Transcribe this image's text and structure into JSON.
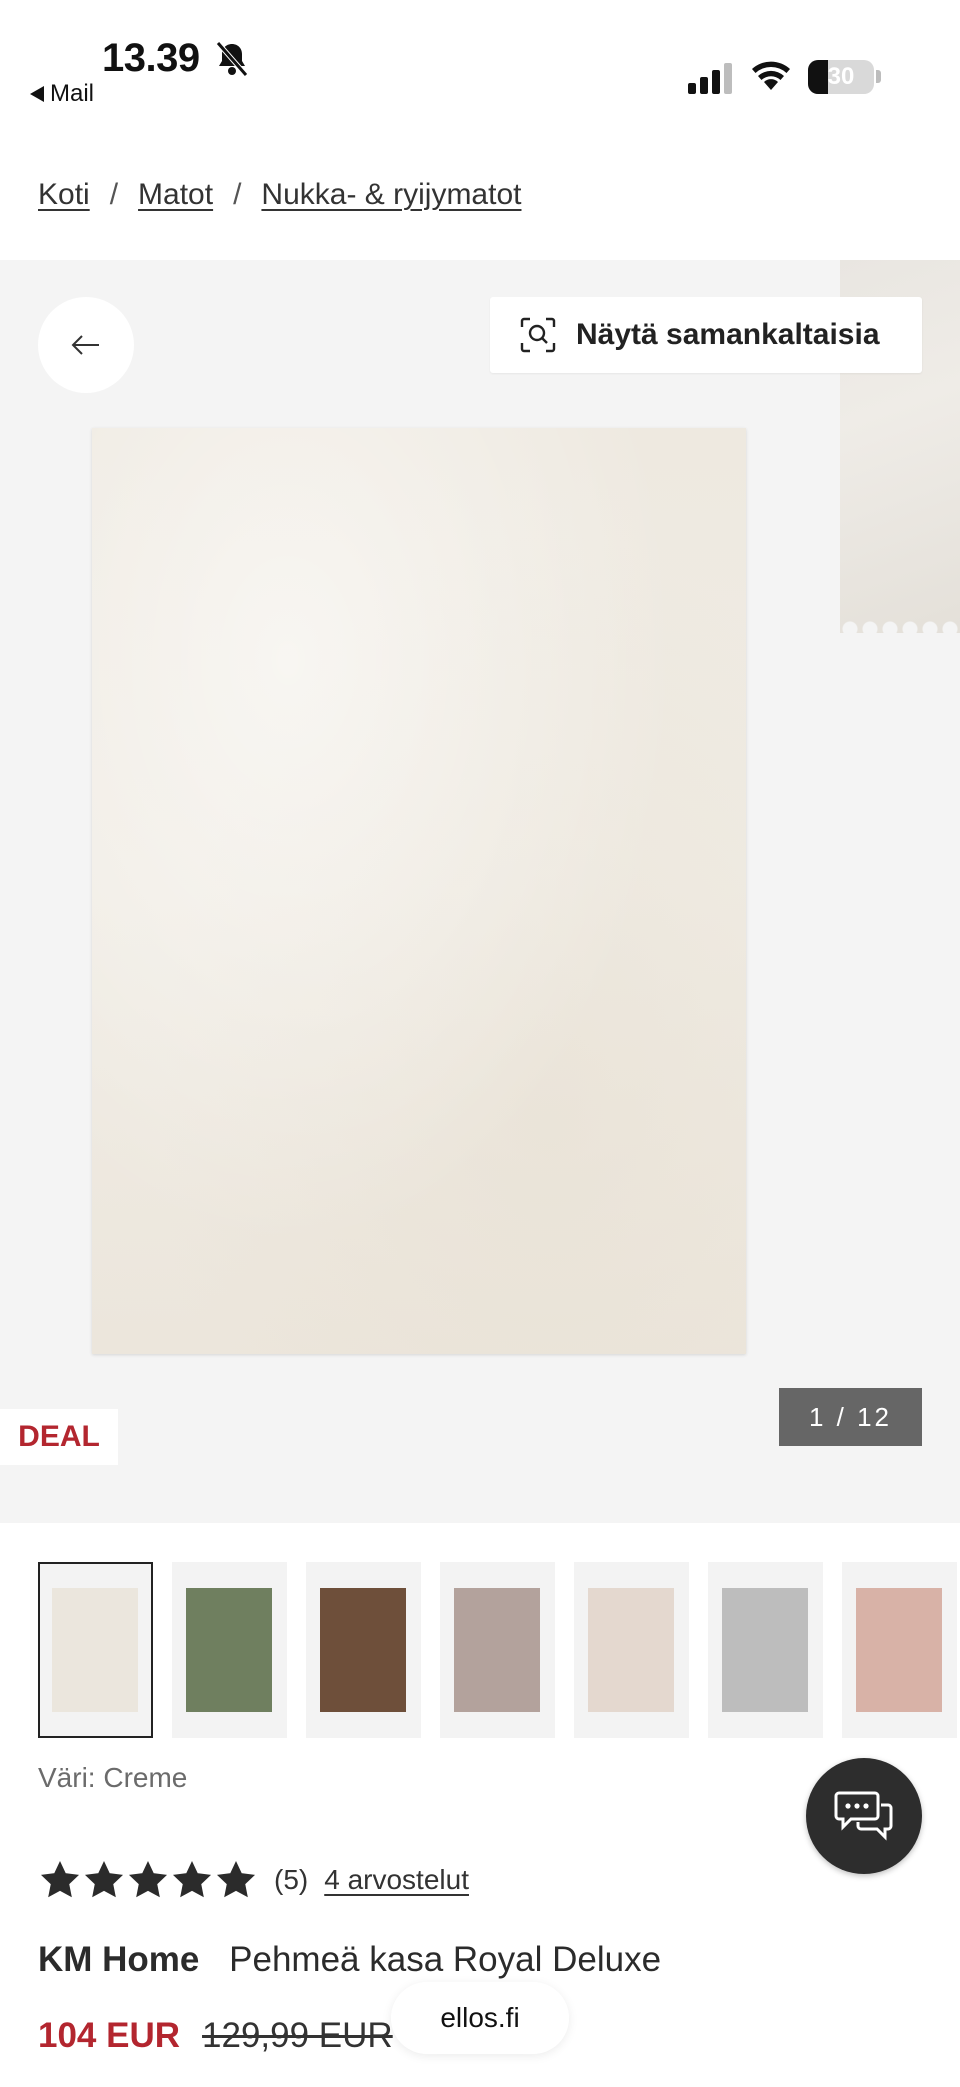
{
  "status_bar": {
    "time": "13.39",
    "back_app": "Mail",
    "battery": "30",
    "battery_level": 0.3
  },
  "breadcrumb": {
    "items": [
      "Koti",
      "Matot",
      "Nukka- & ryijymatot"
    ],
    "separator": "/"
  },
  "gallery": {
    "similar_label": "Näytä samankaltaisia",
    "deal_label": "DEAL",
    "counter": "1 / 12"
  },
  "thumbnails": [
    {
      "color": "#ebe6dd",
      "selected": true
    },
    {
      "color": "#6f7f5f",
      "selected": false
    },
    {
      "color": "#6e4f3a",
      "selected": false
    },
    {
      "color": "#b3a29c",
      "selected": false
    },
    {
      "color": "#e4d8cf",
      "selected": false
    },
    {
      "color": "#bdbdbd",
      "selected": false
    },
    {
      "color": "#d8b2a7",
      "selected": false
    }
  ],
  "product": {
    "color_label": "Väri: Creme",
    "rating_value": 5,
    "rating_count": "(5)",
    "reviews_link": "4 arvostelut",
    "brand": "KM Home",
    "name": "Pehmeä kasa Royal Deluxe",
    "price": "104 EUR",
    "old_price": "129,99 EUR"
  },
  "browser": {
    "url": "ellos.fi"
  },
  "colors": {
    "accent_red": "#b3262f",
    "dark": "#2d2d2d"
  }
}
